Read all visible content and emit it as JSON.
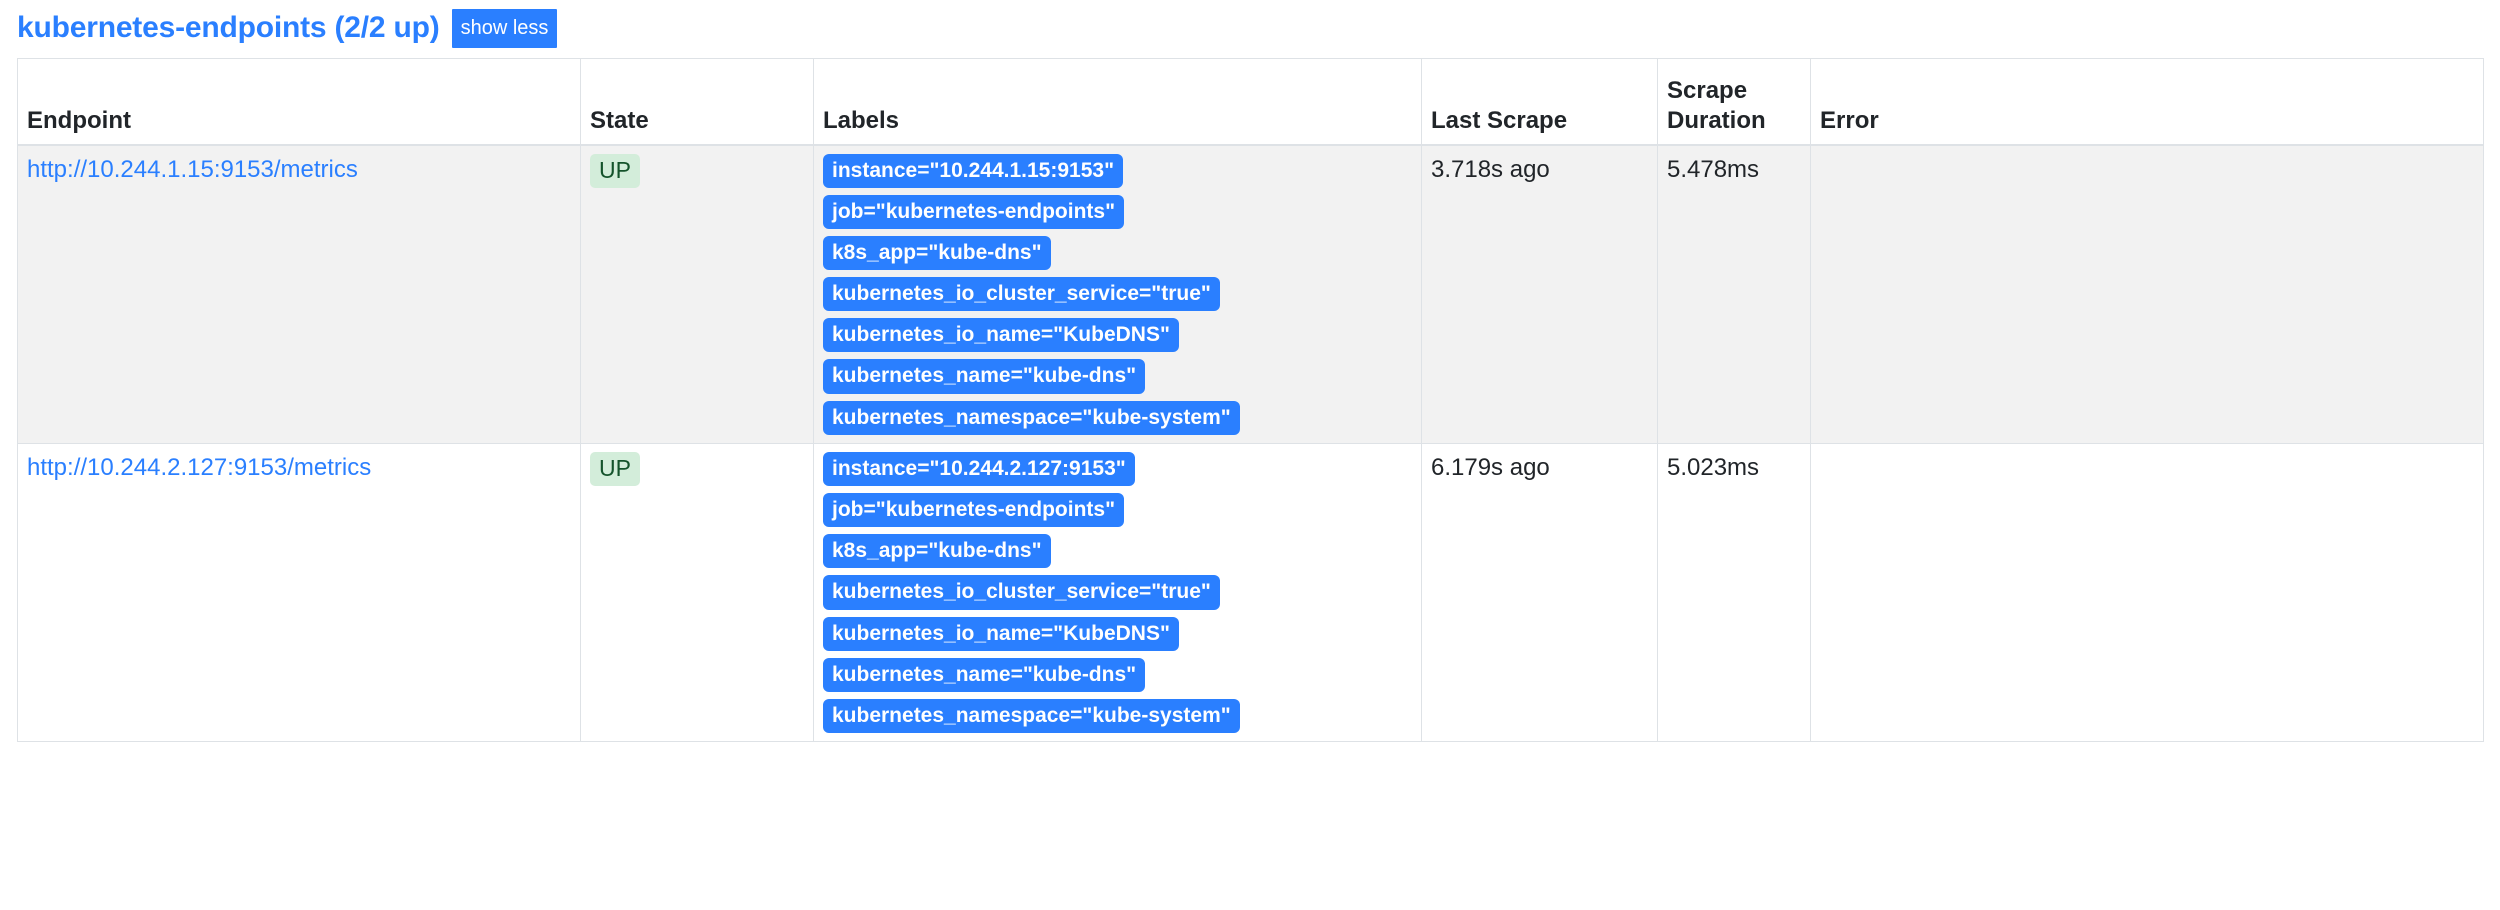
{
  "job": {
    "title": "kubernetes-endpoints (2/2 up)",
    "toggle_label": "show less",
    "accent_color": "#2a7fff",
    "up_badge_bg": "#d3edda",
    "up_badge_color": "#14532b"
  },
  "table": {
    "columns": [
      {
        "key": "endpoint",
        "label": "Endpoint"
      },
      {
        "key": "state",
        "label": "State"
      },
      {
        "key": "labels",
        "label": "Labels"
      },
      {
        "key": "last_scrape",
        "label": "Last Scrape"
      },
      {
        "key": "scrape_duration",
        "label": "Scrape Duration"
      },
      {
        "key": "error",
        "label": "Error"
      }
    ],
    "rows": [
      {
        "endpoint": "http://10.244.1.15:9153/metrics",
        "state": "UP",
        "labels": [
          "instance=\"10.244.1.15:9153\"",
          "job=\"kubernetes-endpoints\"",
          "k8s_app=\"kube-dns\"",
          "kubernetes_io_cluster_service=\"true\"",
          "kubernetes_io_name=\"KubeDNS\"",
          "kubernetes_name=\"kube-dns\"",
          "kubernetes_namespace=\"kube-system\""
        ],
        "last_scrape": "3.718s ago",
        "scrape_duration": "5.478ms",
        "error": ""
      },
      {
        "endpoint": "http://10.244.2.127:9153/metrics",
        "state": "UP",
        "labels": [
          "instance=\"10.244.2.127:9153\"",
          "job=\"kubernetes-endpoints\"",
          "k8s_app=\"kube-dns\"",
          "kubernetes_io_cluster_service=\"true\"",
          "kubernetes_io_name=\"KubeDNS\"",
          "kubernetes_name=\"kube-dns\"",
          "kubernetes_namespace=\"kube-system\""
        ],
        "last_scrape": "6.179s ago",
        "scrape_duration": "5.023ms",
        "error": ""
      }
    ]
  }
}
